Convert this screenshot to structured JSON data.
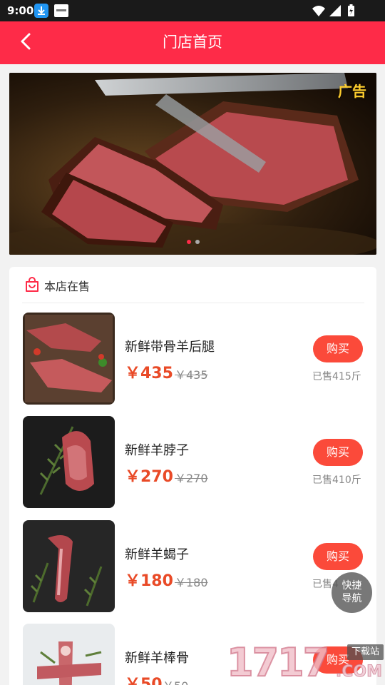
{
  "status_bar": {
    "time": "9:00"
  },
  "header": {
    "title": "门店首页"
  },
  "banner": {
    "ad_label": "广告",
    "slides": 2,
    "active_slide": 1
  },
  "section": {
    "title": "本店在售"
  },
  "products": [
    {
      "name": "新鲜带骨羊后腿",
      "price": "￥435",
      "original_price": "￥435",
      "buy_label": "购买",
      "sold": "已售415斤"
    },
    {
      "name": "新鲜羊脖子",
      "price": "￥270",
      "original_price": "￥270",
      "buy_label": "购买",
      "sold": "已售410斤"
    },
    {
      "name": "新鲜羊蝎子",
      "price": "￥180",
      "original_price": "￥180",
      "buy_label": "购买",
      "sold": "已售4"
    },
    {
      "name": "新鲜羊棒骨",
      "price": "￥50",
      "original_price": "￥50",
      "buy_label": "购买",
      "sold": ""
    }
  ],
  "quick_nav": {
    "line1": "快捷",
    "line2": "导航"
  },
  "watermark": {
    "number": "1717",
    "com": ".COM",
    "tag": "下载站"
  },
  "colors": {
    "header": "#fe2b48",
    "price": "#e94a27",
    "buy_button": "#fb4a3a",
    "ad_label": "#ffce2e"
  }
}
